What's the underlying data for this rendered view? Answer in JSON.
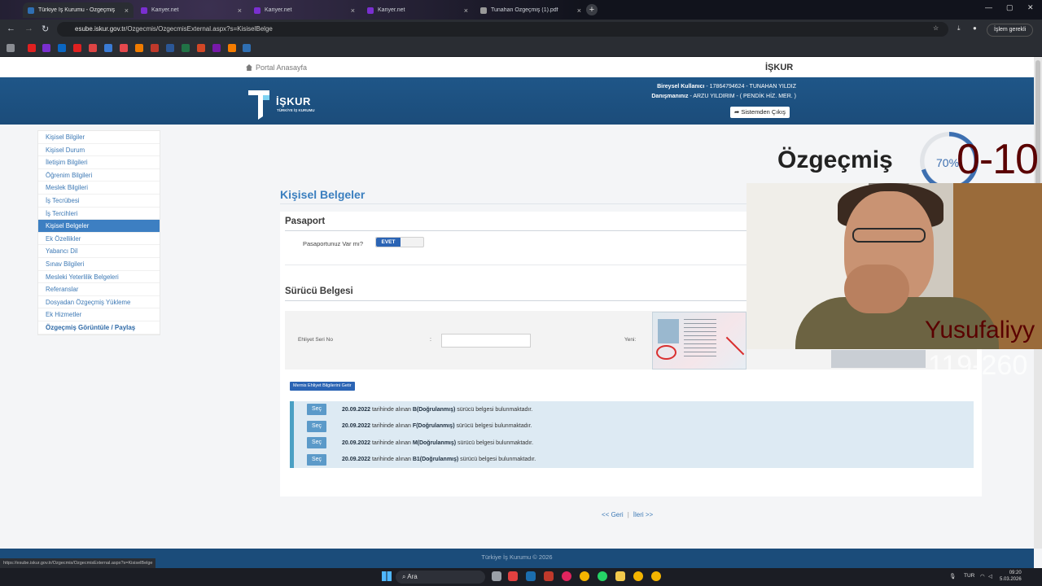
{
  "browser": {
    "tabs": [
      {
        "label": "Türkiye İş Kurumu - Özgeçmiş",
        "color": "#2f6fb3",
        "active": true
      },
      {
        "label": "Kariyer.net",
        "color": "#7a2fd0"
      },
      {
        "label": "Kariyer.net",
        "color": "#7a2fd0"
      },
      {
        "label": "Kariyer.net",
        "color": "#7a2fd0"
      },
      {
        "label": "Tunahan Özgeçmiş (1).pdf",
        "color": "#999999"
      }
    ],
    "url_host": "esube.iskur.gov.tr",
    "url_path": "/Ozgecmis/OzgecmisExternal.aspx?s=KisiselBelge",
    "action_pill": "İşlem gerekli",
    "status_url": "https://esube.iskur.gov.tr/Ozgecmis/OzgecmisExternal.aspx?s=KisiselBelge"
  },
  "site": {
    "portal_link": "Portal Anasayfa",
    "brand_top": "İŞKUR",
    "logo_text": "İŞKUR",
    "logo_sub": "TÜRKİYE İŞ KURUMU",
    "user_label": "Bireysel Kullanıcı",
    "user_value": " - 17864794624 - TUNAHAN YILDIZ",
    "advisor_label": "Danışmanınız",
    "advisor_value": " - ARZU YILDIRIM - ( PENDİK HİZ. MER. )",
    "logout": "Sistemden Çıkış"
  },
  "sidebar": {
    "items": [
      {
        "label": "Kişisel Bilgiler"
      },
      {
        "label": "Kişisel Durum"
      },
      {
        "label": "İletişim Bilgileri"
      },
      {
        "label": "Öğrenim Bilgileri"
      },
      {
        "label": "Meslek Bilgileri"
      },
      {
        "label": "İş Tecrübesi"
      },
      {
        "label": "İş Tercihleri"
      },
      {
        "label": "Kişisel Belgeler"
      },
      {
        "label": "Ek Özellikler"
      },
      {
        "label": "Yabancı Dil"
      },
      {
        "label": "Sınav Bilgileri"
      },
      {
        "label": "Mesleki Yeterlilik Belgeleri"
      },
      {
        "label": "Referanslar"
      },
      {
        "label": "Dosyadan Özgeçmiş Yükleme"
      },
      {
        "label": "Ek Hizmetler"
      },
      {
        "label": "Özgeçmiş Görüntüle / Paylaş"
      }
    ],
    "active_index": 7
  },
  "main": {
    "title": "Kişisel Belgeler",
    "passport_title": "Pasaport",
    "passport_question": "Pasaportunuz Var mı?",
    "passport_toggle": "EVET",
    "license_title": "Sürücü Belgesi",
    "serial_label": "Ehliyet Seri No",
    "colon": ":",
    "serial_value": "",
    "new_label": "Yeni:",
    "fetch_button": "Mernis Ehliyet Bilgilerini Getir",
    "licenses": [
      {
        "select": "Seç",
        "date": "20.09.2022",
        "mid": " tarihinde alınan ",
        "class": "B(Doğrulanmış)",
        "tail": " sürücü belgesi bulunmaktadır."
      },
      {
        "select": "Seç",
        "date": "20.09.2022",
        "mid": " tarihinde alınan ",
        "class": "F(Doğrulanmış)",
        "tail": " sürücü belgesi bulunmaktadır."
      },
      {
        "select": "Seç",
        "date": "20.09.2022",
        "mid": " tarihinde alınan ",
        "class": "M(Doğrulanmış)",
        "tail": " sürücü belgesi bulunmaktadır."
      },
      {
        "select": "Seç",
        "date": "20.09.2022",
        "mid": " tarihinde alınan ",
        "class": "B1(Doğrulanmış)",
        "tail": " sürücü belgesi bulunmaktadır."
      }
    ],
    "back": "<< Geri",
    "pager_sep": "|",
    "next": "İleri >>"
  },
  "footer": "Türkiye İş Kurumu © 2026",
  "overlay": {
    "title": "Özgeçmiş",
    "progress_percent": 70,
    "progress_label": "70%",
    "range_top": "0-10",
    "name": "Yusufaliyy",
    "range_bottom": "119-260"
  },
  "taskbar": {
    "search": "Ara",
    "lang": "TUR",
    "time": "09:20",
    "date": "5.03.2026"
  }
}
